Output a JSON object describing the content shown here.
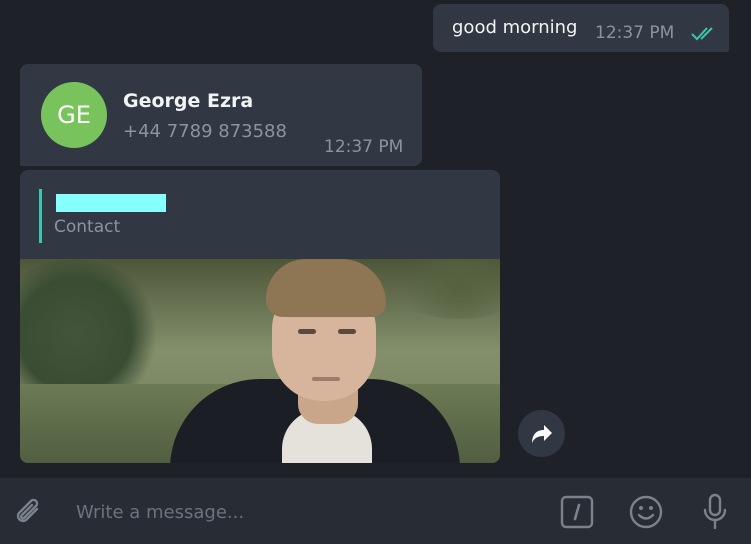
{
  "colors": {
    "background": "#1e2127",
    "bubble": "#323843",
    "composer": "#282d35",
    "read_ticks": "#3cc5ad",
    "avatar": "#79c35d",
    "quote_bar": "#3cc5ad",
    "quote_highlight": "#88ffff"
  },
  "messages": {
    "outgoing": {
      "text": "good morning",
      "time": "12:37 PM",
      "status_icon": "double-check-icon"
    },
    "contact": {
      "initials": "GE",
      "name": "George Ezra",
      "phone": "+44 7789 873588",
      "time": "12:37 PM"
    },
    "reply": {
      "quote_label": "Contact",
      "media_icon": "video-thumbnail"
    }
  },
  "actions": {
    "forward_icon": "forward-icon"
  },
  "composer": {
    "placeholder": "Write a message...",
    "attach_icon": "paperclip-icon",
    "command_icon": "bot-command-icon",
    "emoji_icon": "emoji-icon",
    "mic_icon": "microphone-icon"
  }
}
